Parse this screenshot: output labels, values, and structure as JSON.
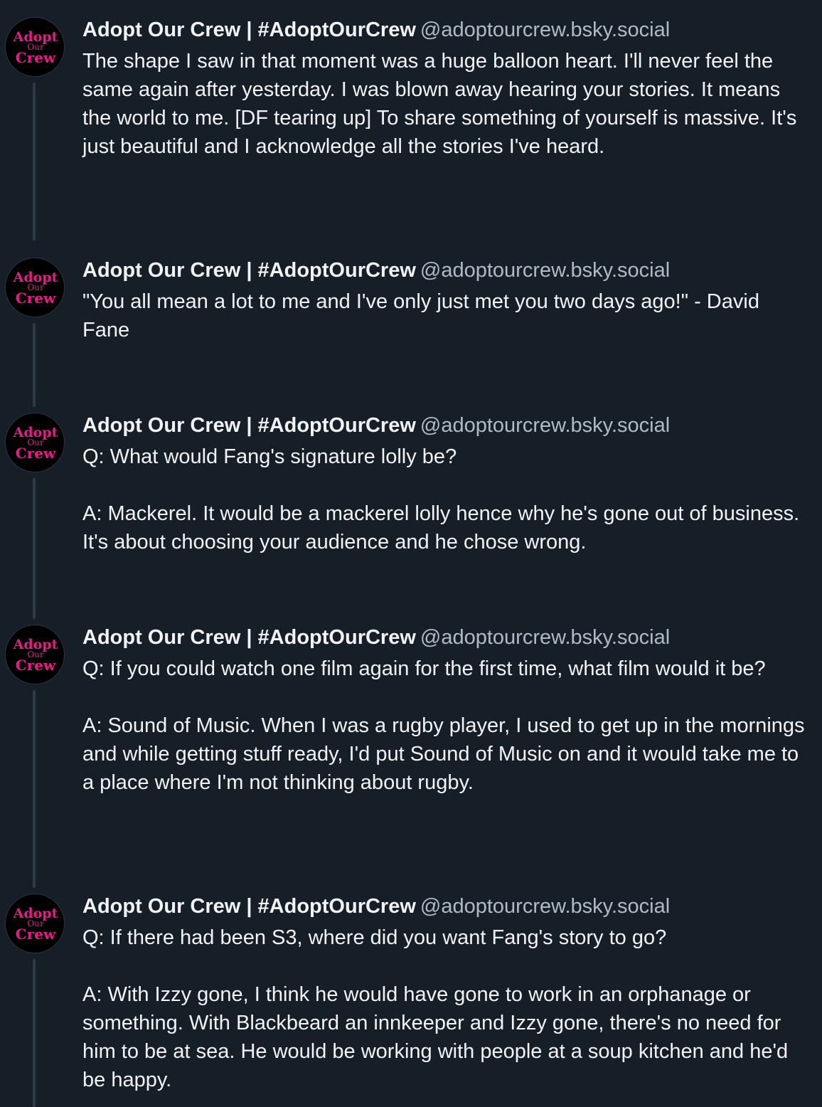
{
  "brand": {
    "accent": "#e8198b",
    "avatar_bg": "#000000",
    "avatar_logo_lines": [
      "Adopt",
      "Our",
      "Crew"
    ]
  },
  "posts": [
    {
      "display_name": "Adopt Our Crew | #AdoptOurCrew",
      "handle": "@adoptourcrew.bsky.social",
      "text": "The shape I saw in that moment was a huge balloon heart. I'll never feel the same again after yesterday. I was blown away hearing your stories. It means the world to me. [DF tearing up] To share something of yourself is massive. It's just beautiful and I acknowledge all the stories I've heard."
    },
    {
      "display_name": "Adopt Our Crew | #AdoptOurCrew",
      "handle": "@adoptourcrew.bsky.social",
      "text": "\"You all mean a lot to me and I've only just met you two days ago!\" - David Fane"
    },
    {
      "display_name": "Adopt Our Crew | #AdoptOurCrew",
      "handle": "@adoptourcrew.bsky.social",
      "text": "Q: What would Fang's signature lolly be?\n\nA: Mackerel. It would be a mackerel lolly hence why he's gone out of business. It's about choosing your audience and he chose wrong."
    },
    {
      "display_name": "Adopt Our Crew | #AdoptOurCrew",
      "handle": "@adoptourcrew.bsky.social",
      "text": "Q: If you could watch one film again for the first time, what film would it be?\n\nA: Sound of Music. When I was a rugby player, I used to get up in the mornings and while getting stuff ready, I'd put Sound of Music on and it would take me to a place where I'm not thinking about rugby."
    },
    {
      "display_name": "Adopt Our Crew | #AdoptOurCrew",
      "handle": "@adoptourcrew.bsky.social",
      "text": "Q: If there had been S3, where did you want Fang's story to go?\n\nA: With Izzy gone, I think he would have gone to work in an orphanage or something. With Blackbeard an innkeeper and Izzy gone, there's no need for him to be at sea. He would be working with people at a soup kitchen and he'd be happy."
    }
  ]
}
